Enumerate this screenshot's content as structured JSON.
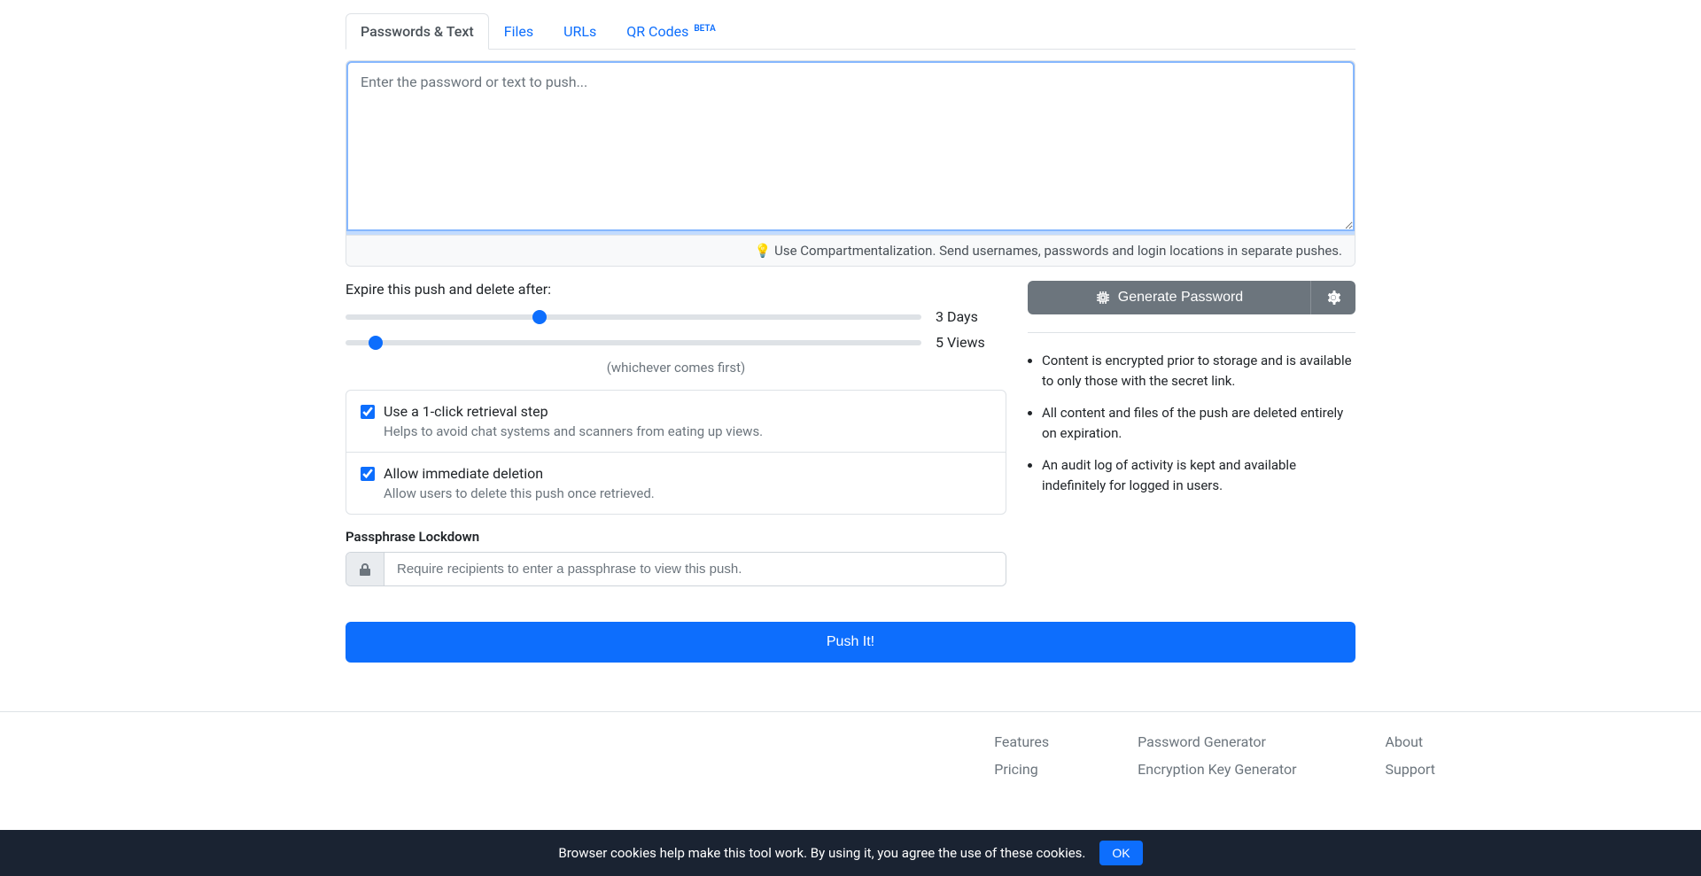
{
  "tabs": {
    "passwords": "Passwords & Text",
    "files": "Files",
    "urls": "URLs",
    "qr": "QR Codes",
    "qr_badge": "BETA"
  },
  "textarea": {
    "placeholder": "Enter the password or text to push...",
    "footer": "💡 Use Compartmentalization. Send usernames, passwords and login locations in separate pushes."
  },
  "expire": {
    "label": "Expire this push and delete after:",
    "days_value": "3 Days",
    "views_value": "5 Views",
    "whichever": "(whichever comes first)"
  },
  "options": {
    "retrieval_title": "Use a 1-click retrieval step",
    "retrieval_desc": "Helps to avoid chat systems and scanners from eating up views.",
    "deletion_title": "Allow immediate deletion",
    "deletion_desc": "Allow users to delete this push once retrieved."
  },
  "passphrase": {
    "label": "Passphrase Lockdown",
    "placeholder": "Require recipients to enter a passphrase to view this push."
  },
  "generate": {
    "button": "Generate Password"
  },
  "info": {
    "item1": "Content is encrypted prior to storage and is available to only those with the secret link.",
    "item2": "All content and files of the push are deleted entirely on expiration.",
    "item3": "An audit log of activity is kept and available indefinitely for logged in users."
  },
  "push_button": "Push It!",
  "footer": {
    "col1": {
      "link1": "Features",
      "link2": "Pricing"
    },
    "col2": {
      "link1": "Password Generator",
      "link2": "Encryption Key Generator"
    },
    "col3": {
      "link1": "About",
      "link2": "Support"
    }
  },
  "cookie": {
    "text": "Browser cookies help make this tool work. By using it, you agree the use of these cookies.",
    "ok": "OK"
  }
}
